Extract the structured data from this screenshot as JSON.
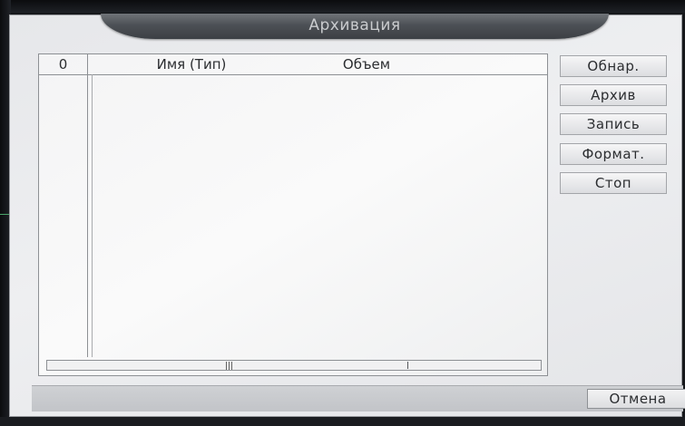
{
  "dialog": {
    "title": "Архивация"
  },
  "device_list": {
    "columns": {
      "index": "0",
      "name": "Имя (Тип)",
      "size": "Объем"
    },
    "rows": [],
    "scrollbar_grip": "|||"
  },
  "actions": {
    "detect": "Обнар.",
    "backup": "Архив",
    "record": "Запись",
    "format": "Формат.",
    "stop": "Стоп"
  },
  "footer": {
    "cancel": "Отмена"
  },
  "colors": {
    "title_bar": "#4c5055",
    "dialog_bg": "#e9eaec",
    "screen_bg": "#16181b"
  }
}
